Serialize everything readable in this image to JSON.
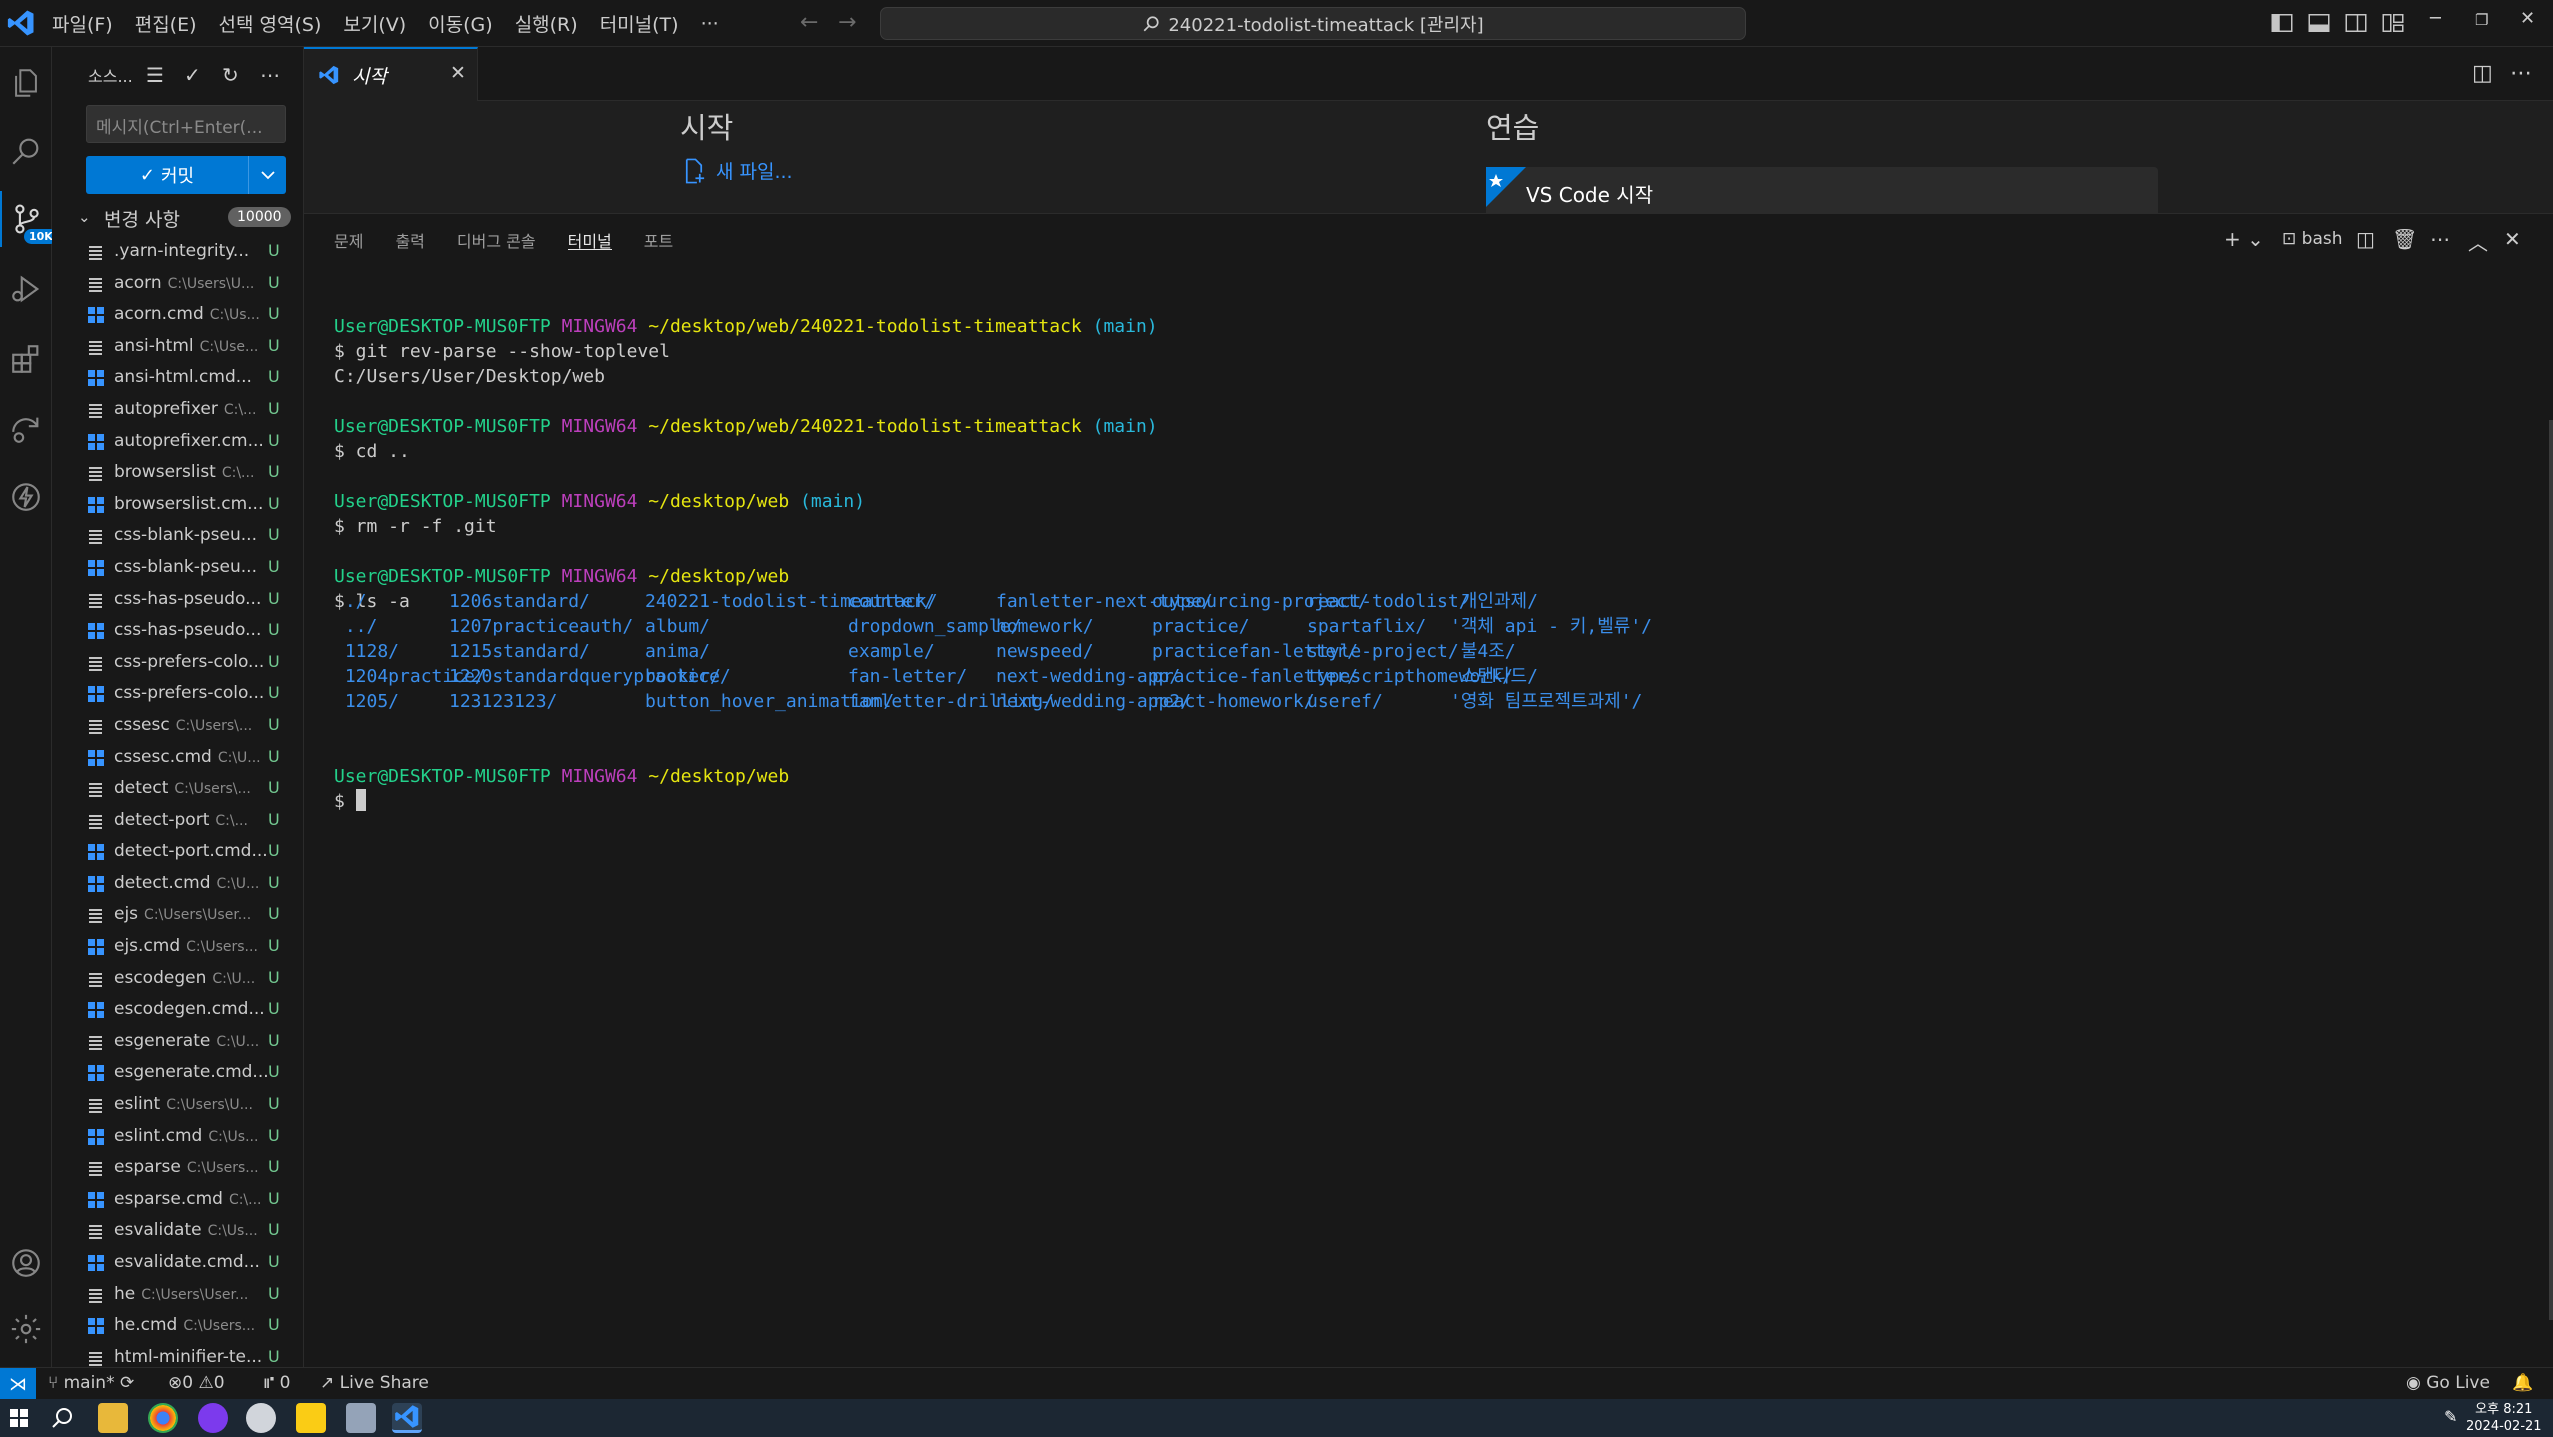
{
  "titlebar": {
    "menus": [
      "파일(F)",
      "편집(E)",
      "선택 영역(S)",
      "보기(V)",
      "이동(G)",
      "실행(R)",
      "터미널(T)",
      "···"
    ],
    "search_text": "240221-todolist-timeattack [관리자]",
    "icons": [
      "vscode-logo",
      "back-arrow",
      "forward-arrow",
      "search-icon",
      "toggle-sidebar",
      "toggle-panel",
      "toggle-secondary",
      "customize-layout",
      "minimize",
      "restore",
      "close"
    ]
  },
  "activity": {
    "items": [
      "explorer-icon",
      "search-icon",
      "source-control-icon",
      "run-debug-icon",
      "extensions-icon",
      "remote-explorer-icon",
      "thunder-icon",
      "accounts-icon",
      "manage-gear-icon"
    ],
    "scm_badge": "10K"
  },
  "sidebar": {
    "title": "소스...",
    "message_placeholder": "메시지(Ctrl+Enter(...",
    "commit_label": "커밋",
    "changes_label": "변경 사항",
    "changes_count": "10000",
    "files": [
      {
        "name": ".yarn-integrity...",
        "path": "",
        "icon": "doc",
        "status": "U"
      },
      {
        "name": "acorn",
        "path": "C:\\Users\\U...",
        "icon": "doc",
        "status": "U"
      },
      {
        "name": "acorn.cmd",
        "path": "C:\\Us...",
        "icon": "win",
        "status": "U"
      },
      {
        "name": "ansi-html",
        "path": "C:\\Use...",
        "icon": "doc",
        "status": "U"
      },
      {
        "name": "ansi-html.cmd...",
        "path": "",
        "icon": "win",
        "status": "U"
      },
      {
        "name": "autoprefixer",
        "path": "C:\\...",
        "icon": "doc",
        "status": "U"
      },
      {
        "name": "autoprefixer.cm...",
        "path": "",
        "icon": "win",
        "status": "U"
      },
      {
        "name": "browserslist",
        "path": "C:\\...",
        "icon": "doc",
        "status": "U"
      },
      {
        "name": "browserslist.cm...",
        "path": "",
        "icon": "win",
        "status": "U"
      },
      {
        "name": "css-blank-pseu...",
        "path": "",
        "icon": "doc",
        "status": "U"
      },
      {
        "name": "css-blank-pseu...",
        "path": "",
        "icon": "win",
        "status": "U"
      },
      {
        "name": "css-has-pseudo...",
        "path": "",
        "icon": "doc",
        "status": "U"
      },
      {
        "name": "css-has-pseudo...",
        "path": "",
        "icon": "win",
        "status": "U"
      },
      {
        "name": "css-prefers-colo...",
        "path": "",
        "icon": "doc",
        "status": "U"
      },
      {
        "name": "css-prefers-colo...",
        "path": "",
        "icon": "win",
        "status": "U"
      },
      {
        "name": "cssesc",
        "path": "C:\\Users\\...",
        "icon": "doc",
        "status": "U"
      },
      {
        "name": "cssesc.cmd",
        "path": "C:\\U...",
        "icon": "win",
        "status": "U"
      },
      {
        "name": "detect",
        "path": "C:\\Users\\...",
        "icon": "doc",
        "status": "U"
      },
      {
        "name": "detect-port",
        "path": "C:\\...",
        "icon": "doc",
        "status": "U"
      },
      {
        "name": "detect-port.cmd...",
        "path": "",
        "icon": "win",
        "status": "U"
      },
      {
        "name": "detect.cmd",
        "path": "C:\\U...",
        "icon": "win",
        "status": "U"
      },
      {
        "name": "ejs",
        "path": "C:\\Users\\User...",
        "icon": "doc",
        "status": "U"
      },
      {
        "name": "ejs.cmd",
        "path": "C:\\Users...",
        "icon": "win",
        "status": "U"
      },
      {
        "name": "escodegen",
        "path": "C:\\U...",
        "icon": "doc",
        "status": "U"
      },
      {
        "name": "escodegen.cmd...",
        "path": "",
        "icon": "win",
        "status": "U"
      },
      {
        "name": "esgenerate",
        "path": "C:\\U...",
        "icon": "doc",
        "status": "U"
      },
      {
        "name": "esgenerate.cmd...",
        "path": "",
        "icon": "win",
        "status": "U"
      },
      {
        "name": "eslint",
        "path": "C:\\Users\\U...",
        "icon": "doc",
        "status": "U"
      },
      {
        "name": "eslint.cmd",
        "path": "C:\\Us...",
        "icon": "win",
        "status": "U"
      },
      {
        "name": "esparse",
        "path": "C:\\Users...",
        "icon": "doc",
        "status": "U"
      },
      {
        "name": "esparse.cmd",
        "path": "C:\\...",
        "icon": "win",
        "status": "U"
      },
      {
        "name": "esvalidate",
        "path": "C:\\Us...",
        "icon": "doc",
        "status": "U"
      },
      {
        "name": "esvalidate.cmd...",
        "path": "",
        "icon": "win",
        "status": "U"
      },
      {
        "name": "he",
        "path": "C:\\Users\\User...",
        "icon": "doc",
        "status": "U"
      },
      {
        "name": "he.cmd",
        "path": "C:\\Users...",
        "icon": "win",
        "status": "U"
      },
      {
        "name": "html-minifier-te...",
        "path": "",
        "icon": "doc",
        "status": "U"
      }
    ]
  },
  "editor": {
    "tab_label": "시작",
    "start_heading": "시작",
    "new_file": "새 파일...",
    "walkthrough_heading": "연습",
    "walkthrough_card": "VS Code 시작"
  },
  "panel": {
    "tabs": [
      "문제",
      "출력",
      "디버그 콘솔",
      "터미널",
      "포트"
    ],
    "active_tab": "터미널",
    "shell_label": "bash"
  },
  "terminal": {
    "prompt_user": "User@DESKTOP-MUS0FTP",
    "prompt_env": "MINGW64",
    "blocks": [
      {
        "path": "~/desktop/web/240221-todolist-timeattack",
        "branch": "(main)",
        "cmd": "$ git rev-parse --show-toplevel",
        "output": "C:/Users/User/Desktop/web"
      },
      {
        "path": "~/desktop/web/240221-todolist-timeattack",
        "branch": "(main)",
        "cmd": "$ cd ..",
        "output": ""
      },
      {
        "path": "~/desktop/web",
        "branch": "(main)",
        "cmd": "$ rm -r -f .git",
        "output": ""
      },
      {
        "path": "~/desktop/web",
        "branch": "",
        "cmd": "$ ls -a",
        "output": ""
      }
    ],
    "ls_columns": [
      [
        " ./",
        " ../",
        " 1128/",
        " 1204practice/",
        " 1205/"
      ],
      [
        "1206standard/",
        "1207practiceauth/",
        "1215standard/",
        "1220standardquerypractice/",
        "123123123/"
      ],
      [
        "240221-todolist-timeattack/",
        "album/",
        "anima/",
        "booker/",
        "button_hover_animation/"
      ],
      [
        "counter/",
        "dropdown_sample/",
        "example/",
        "fan-letter/",
        "fanletter-drilling/"
      ],
      [
        "fanletter-next-type/",
        "homework/",
        "newspeed/",
        "next-wedding-app/",
        "next-wedding-app2/"
      ],
      [
        "outsourcing-project/",
        "practice/",
        "practicefan-letter/",
        "practice-fanletter/",
        "react-homework/"
      ],
      [
        "react-todolist/",
        "spartaflix/",
        "style-project/",
        "typescripthomework/",
        "useref/"
      ],
      [
        " 개인과제/",
        "'객체 api - 키,벨류'/",
        " 불4조/",
        " 스탠다드/",
        "'영화 팀프로젝트과제'/"
      ]
    ],
    "last_prompt_path": "~/desktop/web",
    "last_cmd": "$ "
  },
  "statusbar": {
    "branch": "main*",
    "errors": "0",
    "warnings": "0",
    "ports": "0",
    "live_share": "Live Share",
    "go_live": "Go Live"
  },
  "taskbar": {
    "time": "오후 8:21",
    "date": "2024-02-21"
  },
  "colors": {
    "accent": "#0078d4",
    "prompt_user": "#23d18b",
    "prompt_env": "#bc3fbc",
    "prompt_path": "#e5e510",
    "branch": "#29b8db",
    "dir": "#3b8eea",
    "untracked": "#73c991"
  }
}
